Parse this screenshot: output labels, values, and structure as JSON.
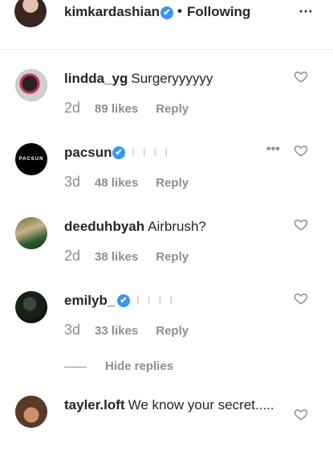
{
  "post_header": {
    "username": "kimkardashian",
    "separator": "•",
    "follow_status": "Following",
    "more_icon": "⋯"
  },
  "comments": [
    {
      "username": "lindda_yg",
      "text": "Surgeryyyyyy",
      "time": "2d",
      "likes": "89 likes",
      "reply": "Reply",
      "verified": false
    },
    {
      "username": "pacsun",
      "text": "",
      "redacted": "I I I I",
      "time": "3d",
      "likes": "48 likes",
      "reply": "Reply",
      "verified": true,
      "avatar_text": "PACSUN",
      "more_icon": "•••"
    },
    {
      "username": "deeduhbyah",
      "text": "Airbrush?",
      "time": "2d",
      "likes": "38 likes",
      "reply": "Reply",
      "verified": false
    },
    {
      "username": "emilyb_",
      "text": "",
      "redacted": "I I I I",
      "time": "3d",
      "likes": "33 likes",
      "reply": "Reply",
      "verified": true
    }
  ],
  "hide_replies_label": "Hide replies",
  "last_comment": {
    "username": "tayler.loft",
    "text": "We know your secret....."
  },
  "icons": {
    "heart": "heart-outline-icon",
    "verified": "verified-badge-icon",
    "check": "✔"
  },
  "colors": {
    "verified": "#3897f0",
    "muted": "#8e8e8e",
    "text": "#262626"
  }
}
